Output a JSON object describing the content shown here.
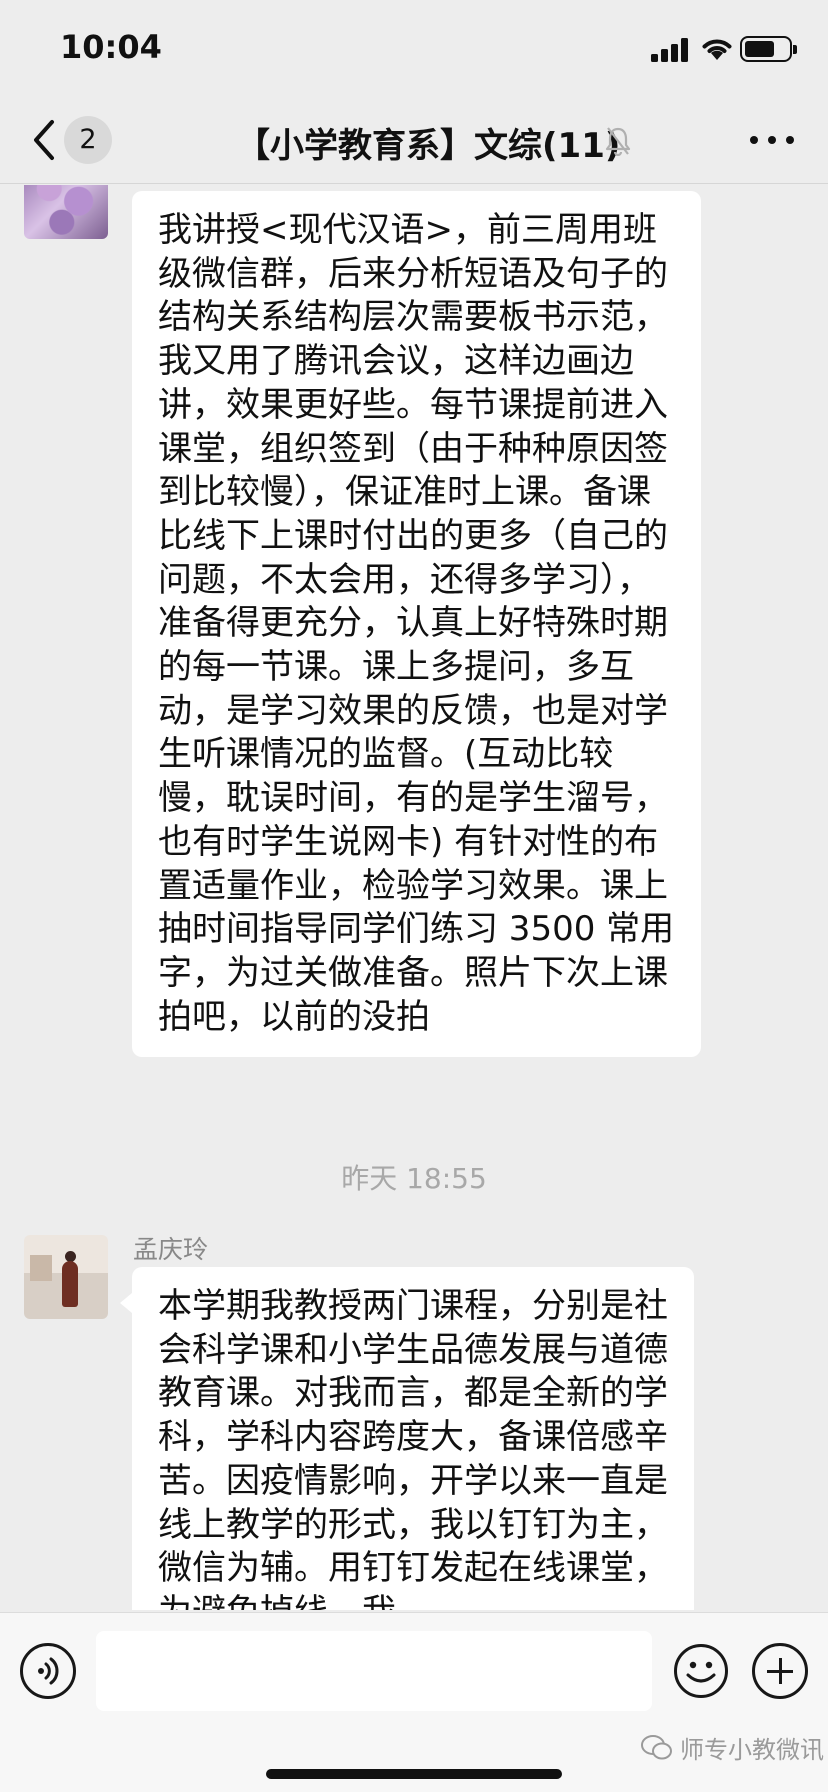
{
  "status_bar": {
    "time": "10:04",
    "battery_level": 0.68
  },
  "nav": {
    "unread_count": "2",
    "title": "【小学教育系】文综(11)",
    "icons": [
      "back-chevron-icon",
      "mute-bell-icon",
      "more-dots-icon"
    ]
  },
  "messages": [
    {
      "text": "我讲授<现代汉语>，前三周用班级微信群，后来分析短语及句子的结构关系结构层次需要板书示范，我又用了腾讯会议，这样边画边讲，效果更好些。每节课提前进入课堂，组织签到（由于种种原因签到比较慢），保证准时上课。备课比线下上课时付出的更多（自己的问题，不太会用，还得多学习），准备得更充分，认真上好特殊时期的每一节课。课上多提问，多互动，是学习效果的反馈，也是对学生听课情况的监督。(互动比较慢，耽误时间，有的是学生溜号，也有时学生说网卡) 有针对性的布置适量作业，检验学习效果。课上抽时间指导同学们练习 3500 常用字，为过关做准备。照片下次上课拍吧，以前的没拍"
    },
    {
      "sender": "孟庆玲",
      "text": "本学期我教授两门课程，分别是社会科学课和小学生品德发展与道德教育课。对我而言，都是全新的学科，学科内容跨度大，备课倍感辛苦。因疫情影响，开学以来一直是线上教学的形式，我以钉钉为主，微信为辅。用钉钉发起在线课堂，为避免掉线，我"
    }
  ],
  "time_divider": "昨天 18:55",
  "input_bar": {
    "icons": [
      "voice-icon",
      "emoji-icon",
      "plus-icon"
    ]
  },
  "watermark": "师专小教微讯"
}
